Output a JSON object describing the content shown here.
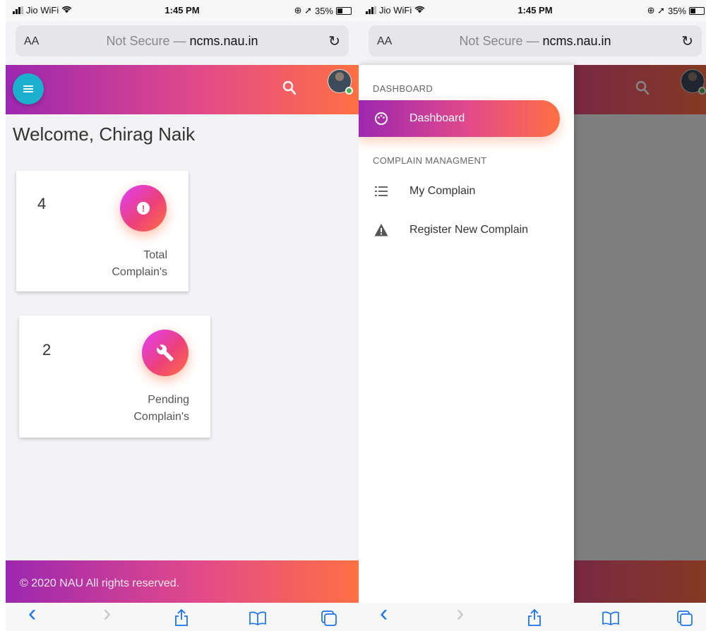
{
  "status_bar": {
    "carrier": "Jio WiFi",
    "time": "1:45 PM",
    "battery": "35%",
    "right_icons": "⊕ ➚"
  },
  "url_bar": {
    "text_size": "AA",
    "prefix": "Not Secure — ",
    "domain": "ncms.nau.in"
  },
  "header": {
    "accent": "#9c27b0",
    "menu_color": "#1bb0d0"
  },
  "welcome": "Welcome, Chirag Naik",
  "cards": [
    {
      "count": "4",
      "label_line1": "Total",
      "label_line2": "Complain's"
    },
    {
      "count": "2",
      "label_line1": "Pending",
      "label_line2": "Complain's"
    }
  ],
  "footer": "© 2020 NAU All rights reserved.",
  "drawer": {
    "section_dashboard": "DASHBOARD",
    "dashboard": "Dashboard",
    "section_complain": "COMPLAIN MANAGMENT",
    "my_complain": "My Complain",
    "register": "Register New Complain"
  },
  "toolbar": {
    "back": "‹",
    "forward": "›"
  }
}
